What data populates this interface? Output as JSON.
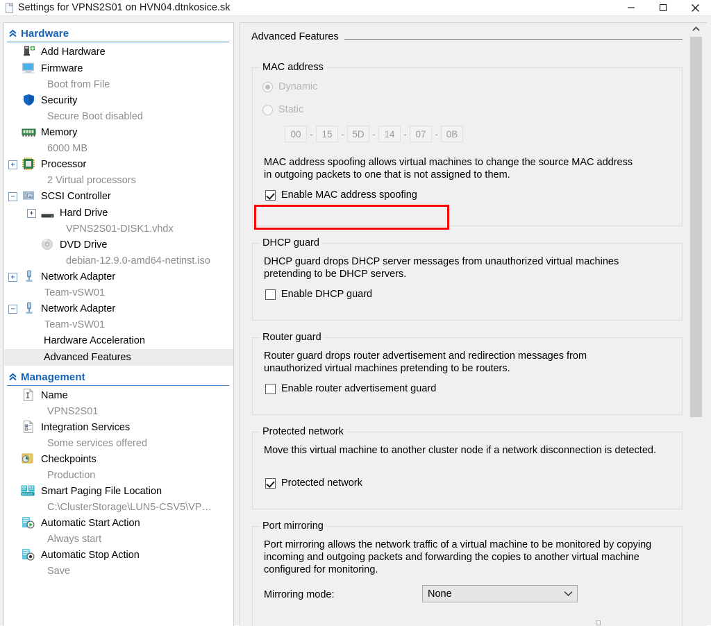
{
  "window": {
    "title": "Settings for VPNS2S01 on HVN04.dtnkosice.sk",
    "icon": "vm-settings-icon",
    "minimize_label": "Minimize",
    "maximize_label": "Maximize",
    "close_label": "Close"
  },
  "sidebar": {
    "sections": [
      {
        "id": "hardware",
        "label": "Hardware",
        "chevron": "chevron-up-double",
        "items": [
          {
            "label": "Add Hardware",
            "sub": null,
            "icon": "add-hardware-icon",
            "indent": 0,
            "expander": null,
            "selected": false
          },
          {
            "label": "Firmware",
            "sub": "Boot from File",
            "icon": "firmware-icon",
            "indent": 0,
            "expander": null,
            "selected": false
          },
          {
            "label": "Security",
            "sub": "Secure Boot disabled",
            "icon": "security-icon",
            "indent": 0,
            "expander": null,
            "selected": false
          },
          {
            "label": "Memory",
            "sub": "6000 MB",
            "icon": "memory-icon",
            "indent": 0,
            "expander": null,
            "selected": false
          },
          {
            "label": "Processor",
            "sub": "2 Virtual processors",
            "icon": "processor-icon",
            "indent": 0,
            "expander": "plus",
            "selected": false
          },
          {
            "label": "SCSI Controller",
            "sub": null,
            "icon": "scsi-controller-icon",
            "indent": 0,
            "expander": "minus",
            "selected": false
          },
          {
            "label": "Hard Drive",
            "sub": "VPNS2S01-DISK1.vhdx",
            "icon": "hard-drive-icon",
            "indent": 1,
            "expander": "plus",
            "selected": false
          },
          {
            "label": "DVD Drive",
            "sub": "debian-12.9.0-amd64-netinst.iso",
            "icon": "dvd-drive-icon",
            "indent": 1,
            "expander": null,
            "selected": false
          },
          {
            "label": "Network Adapter",
            "sub": "Team-vSW01",
            "icon": "network-adapter-icon",
            "indent": 0,
            "expander": "plus",
            "selected": false
          },
          {
            "label": "Network Adapter",
            "sub": "Team-vSW01",
            "icon": "network-adapter-icon",
            "indent": 0,
            "expander": "minus",
            "selected": false
          },
          {
            "label": "Hardware Acceleration",
            "sub": null,
            "icon": null,
            "indent": 2,
            "expander": null,
            "selected": false
          },
          {
            "label": "Advanced Features",
            "sub": null,
            "icon": null,
            "indent": 2,
            "expander": null,
            "selected": true
          }
        ]
      },
      {
        "id": "management",
        "label": "Management",
        "chevron": "chevron-up-double",
        "items": [
          {
            "label": "Name",
            "sub": "VPNS2S01",
            "icon": "name-icon",
            "indent": 0,
            "expander": null,
            "selected": false
          },
          {
            "label": "Integration Services",
            "sub": "Some services offered",
            "icon": "integration-services-icon",
            "indent": 0,
            "expander": null,
            "selected": false
          },
          {
            "label": "Checkpoints",
            "sub": "Production",
            "icon": "checkpoints-icon",
            "indent": 0,
            "expander": null,
            "selected": false
          },
          {
            "label": "Smart Paging File Location",
            "sub": "C:\\ClusterStorage\\LUN5-CSV5\\VP…",
            "icon": "smart-paging-icon",
            "indent": 0,
            "expander": null,
            "selected": false
          },
          {
            "label": "Automatic Start Action",
            "sub": "Always start",
            "icon": "auto-start-icon",
            "indent": 0,
            "expander": null,
            "selected": false
          },
          {
            "label": "Automatic Stop Action",
            "sub": "Save",
            "icon": "auto-stop-icon",
            "indent": 0,
            "expander": null,
            "selected": false
          }
        ]
      }
    ]
  },
  "page": {
    "title": "Advanced Features",
    "mac": {
      "group_title": "MAC address",
      "dynamic_label": "Dynamic",
      "static_label": "Static",
      "dynamic_selected": true,
      "static_selected": false,
      "disabled": true,
      "octets": [
        "00",
        "15",
        "5D",
        "14",
        "07",
        "0B"
      ],
      "separator": "-",
      "spoofing_description": "MAC address spoofing allows virtual machines to change the source MAC address in outgoing packets to one that is not assigned to them.",
      "spoofing_checkbox_label": "Enable MAC address spoofing",
      "spoofing_checked": true
    },
    "dhcp_guard": {
      "group_title": "DHCP guard",
      "description": "DHCP guard drops DHCP server messages from unauthorized virtual machines pretending to be DHCP servers.",
      "checkbox_label": "Enable DHCP guard",
      "checked": false
    },
    "router_guard": {
      "group_title": "Router guard",
      "description": "Router guard drops router advertisement and redirection messages from unauthorized virtual machines pretending to be routers.",
      "checkbox_label": "Enable router advertisement guard",
      "checked": false
    },
    "protected_network": {
      "group_title": "Protected network",
      "description": "Move this virtual machine to another cluster node if a network disconnection is detected.",
      "checkbox_label": "Protected network",
      "checked": true
    },
    "port_mirroring": {
      "group_title": "Port mirroring",
      "description": "Port mirroring allows the network traffic of a virtual machine to be monitored by copying incoming and outgoing packets and forwarding the copies to another virtual machine configured for monitoring.",
      "mode_label": "Mirroring mode:",
      "mode_value": "None"
    }
  },
  "annotation": {
    "highlight_color": "#fe0000",
    "highlight_target": "Enable MAC address spoofing"
  },
  "colors": {
    "section_header": "#1562b4",
    "section_rule": "#3f8cd0",
    "sub_text": "#8c8c8c",
    "panel_bg": "#f0f0f0",
    "selection_bg": "#ececec",
    "disabled_text": "#b4b4b4"
  },
  "scrollbar": {
    "up_arrow": "chevron-up-icon",
    "thumb_position": "top"
  }
}
